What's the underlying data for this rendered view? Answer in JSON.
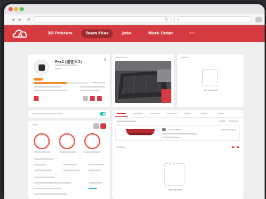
{
  "nav": {
    "items": [
      "3D Printers",
      "Team Files",
      "Jobs",
      "Work Order",
      "···"
    ],
    "active": "Team Files"
  },
  "colors": {
    "brand": "#d43a3f",
    "brand_dark": "#9e2a2e",
    "accent_orange": "#f08c2b",
    "ring_red": "#e85a4f",
    "toggle_teal": "#2dbfb8"
  },
  "printer": {
    "name": "Pro2 (遠征ラス)",
    "placeholder_text": "No content"
  },
  "files": {
    "empty_text": "No content"
  }
}
